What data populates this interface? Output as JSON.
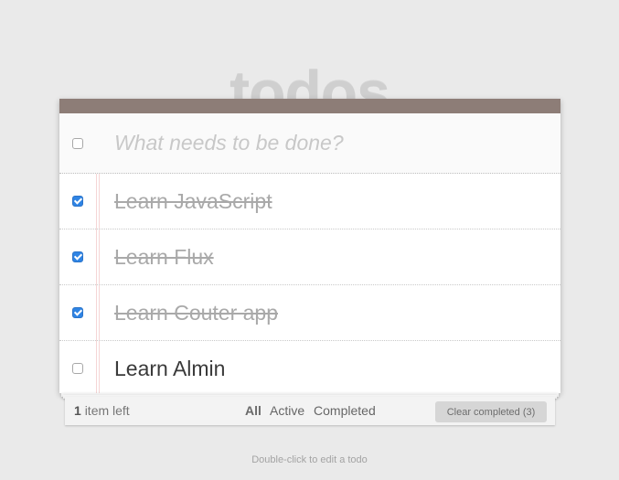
{
  "header": {
    "title": "todos"
  },
  "new_todo": {
    "placeholder": "What needs to be done?",
    "value": ""
  },
  "todos": [
    {
      "label": "Learn JavaScript",
      "completed": true
    },
    {
      "label": "Learn Flux",
      "completed": true
    },
    {
      "label": "Learn Couter app",
      "completed": true
    },
    {
      "label": "Learn Almin",
      "completed": false
    }
  ],
  "footer": {
    "count": "1",
    "count_suffix": "item left",
    "filters": [
      "All",
      "Active",
      "Completed"
    ],
    "selected_filter": "All",
    "clear_label": "Clear completed (3)"
  },
  "hint": "Double-click to edit a todo",
  "colors": {
    "topbar": "#8d7d77",
    "checkbox_checked": "#2f84e4",
    "title": "#cfcfcf"
  }
}
